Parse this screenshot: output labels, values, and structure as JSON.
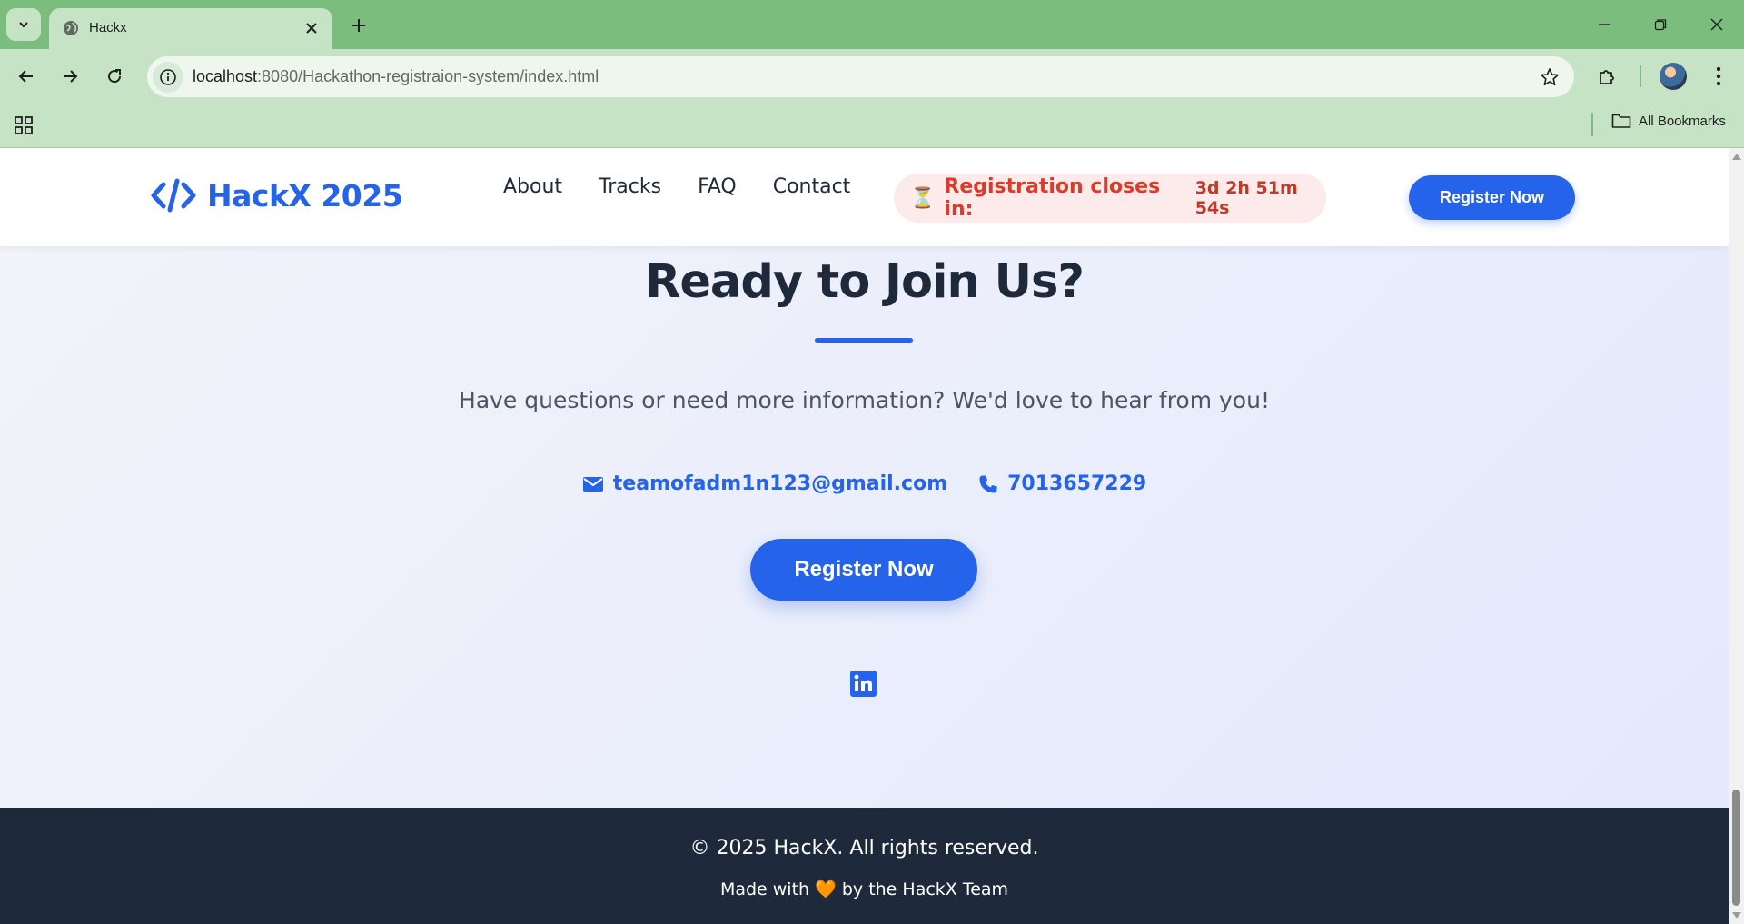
{
  "browser": {
    "tab_title": "Hackx",
    "url_host": "localhost",
    "url_rest": ":8080/Hackathon-registraion-system/index.html",
    "bookmarks_label": "All Bookmarks"
  },
  "header": {
    "logo_text": "HackX 2025",
    "nav": [
      {
        "label": "About"
      },
      {
        "label": "Tracks"
      },
      {
        "label": "FAQ"
      },
      {
        "label": "Contact"
      }
    ],
    "countdown_icon": "⏳",
    "countdown_label": "Registration closes in:",
    "countdown_value": "3d 2h 51m 54s",
    "register_label": "Register Now"
  },
  "contact": {
    "title": "Ready to Join Us?",
    "subtitle": "Have questions or need more information? We'd love to hear from you!",
    "email": "teamofadm1n123@gmail.com",
    "phone": "7013657229",
    "register_label": "Register Now",
    "social": [
      "linkedin-icon"
    ]
  },
  "footer": {
    "copyright": "© 2025 HackX. All rights reserved.",
    "made_prefix": "Made with",
    "heart": "🧡",
    "made_suffix": "by the HackX Team"
  },
  "colors": {
    "brand": "#2563eb",
    "countdown_text": "#dc3b2b",
    "footer_bg": "#1e293b",
    "chrome_green": "#7bbd7c"
  }
}
